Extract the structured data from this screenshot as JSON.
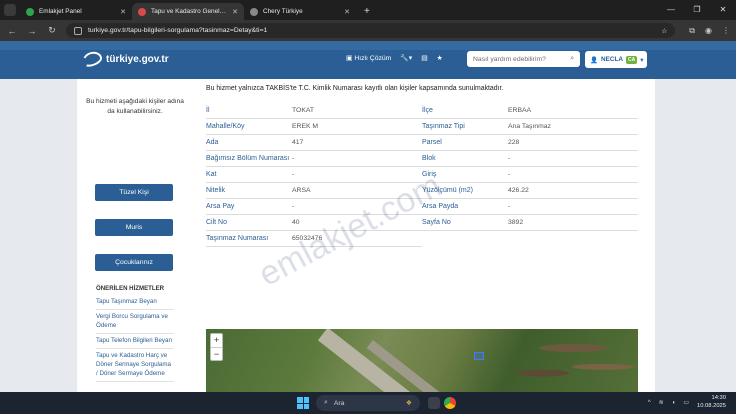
{
  "browser": {
    "tabs": [
      {
        "label": "Emlakjet Panel",
        "color": "#2ea44f",
        "active": false
      },
      {
        "label": "Tapu ve Kadastro Genel Müdürlü...",
        "color": "#d94a4a",
        "active": true
      },
      {
        "label": "Chery Türkiye",
        "color": "#888888",
        "active": false
      }
    ],
    "new_tab": "+",
    "url": "turkiye.gov.tr/tapu-bilgileri-sorgulama?tasinmaz=Detay&ti=1"
  },
  "site": {
    "logo": "türkiye.gov.tr",
    "quick_solution": "Hızlı Çözüm",
    "search_placeholder": "Nasıl yardım edebilirim?",
    "user_name": "NECLA",
    "user_badge": "CA"
  },
  "sidebar": {
    "note": "Bu hizmeti aşağıdaki kişiler adına da kullanabilirsiniz.",
    "buttons": [
      "Tüzel Kişi",
      "Muris",
      "Çocuklarınız"
    ],
    "section_title": "ÖNERİLEN HİZMETLER",
    "links": [
      "Tapu Taşınmaz Beyan",
      "Vergi Borcu Sorgulama ve Ödeme",
      "Tapu Telefon Bilgileri Beyan",
      "Tapu ve Kadastro Harç ve Döner Sermaye Sorgulama / Döner Sermaye Ödeme"
    ]
  },
  "content": {
    "intro": "Bu hizmet yalnızca TAKBİS'te T.C. Kimlik Numarası kayıtlı olan kişiler kapsamında sunulmaktadır.",
    "fields": [
      [
        {
          "label": "İl",
          "value": "TOKAT"
        },
        {
          "label": "İlçe",
          "value": "ERBAA"
        }
      ],
      [
        {
          "label": "Mahalle/Köy",
          "value": "EREK M"
        },
        {
          "label": "Taşınmaz Tipi",
          "value": "Ana Taşınmaz"
        }
      ],
      [
        {
          "label": "Ada",
          "value": "417"
        },
        {
          "label": "Parsel",
          "value": "228"
        }
      ],
      [
        {
          "label": "Bağımsız Bölüm Numarası",
          "value": "-"
        },
        {
          "label": "Blok",
          "value": "-"
        }
      ],
      [
        {
          "label": "Kat",
          "value": "-"
        },
        {
          "label": "Giriş",
          "value": "-"
        }
      ],
      [
        {
          "label": "Nitelik",
          "value": "ARSA"
        },
        {
          "label": "Yüzölçümü (m2)",
          "value": "426.22"
        }
      ],
      [
        {
          "label": "Arsa Pay",
          "value": "-"
        },
        {
          "label": "Arsa Payda",
          "value": "-"
        }
      ],
      [
        {
          "label": "Cilt No",
          "value": "40"
        },
        {
          "label": "Sayfa No",
          "value": "3892"
        }
      ],
      [
        {
          "label": "Taşınmaz Numarası",
          "value": "65032476"
        }
      ]
    ],
    "map_zoom_in": "+",
    "map_zoom_out": "−"
  },
  "watermark": "emlakjet.com",
  "taskbar": {
    "search_text": "Ara",
    "time": "14:30",
    "date": "10.08.2025"
  }
}
